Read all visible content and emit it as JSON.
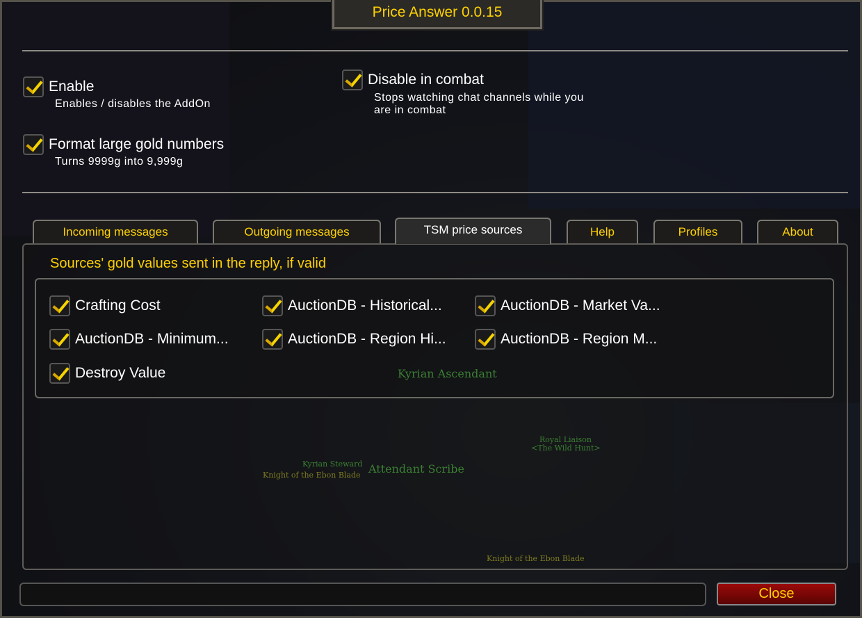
{
  "window": {
    "title": "Price Answer 0.0.15"
  },
  "general": [
    {
      "label": "Enable",
      "desc": "Enables / disables the AddOn",
      "checked": true
    },
    {
      "label": "Disable in combat",
      "desc": "Stops watching chat channels while you are in combat",
      "checked": true
    },
    {
      "label": "Format large gold numbers",
      "desc": "Turns 9999g into 9,999g",
      "checked": true
    }
  ],
  "tabs": [
    {
      "label": "Incoming messages"
    },
    {
      "label": "Outgoing messages"
    },
    {
      "label": "TSM price sources",
      "active": true
    },
    {
      "label": "Help"
    },
    {
      "label": "Profiles"
    },
    {
      "label": "About"
    }
  ],
  "panel": {
    "title": "Sources' gold values sent in the reply, if valid",
    "sources": [
      {
        "label": "Crafting Cost",
        "checked": true
      },
      {
        "label": "AuctionDB - Historical...",
        "checked": true
      },
      {
        "label": "AuctionDB - Market Va...",
        "checked": true
      },
      {
        "label": "AuctionDB - Minimum...",
        "checked": true
      },
      {
        "label": "AuctionDB - Region Hi...",
        "checked": true
      },
      {
        "label": "AuctionDB - Region M...",
        "checked": true
      },
      {
        "label": "Destroy Value",
        "checked": true
      }
    ]
  },
  "footer": {
    "close_label": "Close",
    "status": ""
  },
  "background_nameplates": [
    "Kyrian Ascendant",
    "Royal Liaison",
    "<The Wild Hunt>",
    "Kyrian Steward",
    "Knight of the Ebon Blade",
    "Attendant Scribe",
    "Knight of the Ebon Blade"
  ],
  "colors": {
    "gold": "#ffd100",
    "close_button": "#8a0806"
  }
}
